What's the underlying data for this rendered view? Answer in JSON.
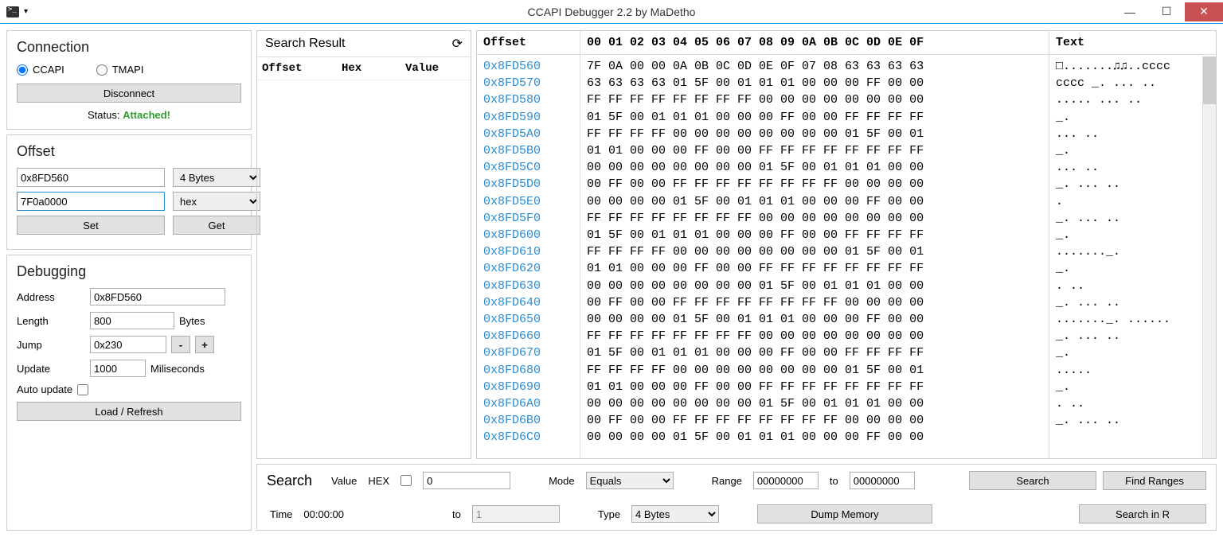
{
  "window": {
    "title": "CCAPI Debugger 2.2 by MaDetho"
  },
  "connection": {
    "title": "Connection",
    "radio_ccapi": "CCAPI",
    "radio_tmapi": "TMAPI",
    "disconnect": "Disconnect",
    "status_label": "Status: ",
    "status_value": "Attached!"
  },
  "offset": {
    "title": "Offset",
    "addr": "0x8FD560",
    "val": "7F0a0000",
    "size_options": "4 Bytes",
    "format": "hex",
    "set": "Set",
    "get": "Get"
  },
  "debugging": {
    "title": "Debugging",
    "address_label": "Address",
    "address": "0x8FD560",
    "length_label": "Length",
    "length": "800",
    "length_unit": "Bytes",
    "jump_label": "Jump",
    "jump": "0x230",
    "update_label": "Update",
    "update": "1000",
    "update_unit": "Miliseconds",
    "autoupdate": "Auto update",
    "load": "Load / Refresh"
  },
  "search_result": {
    "title": "Search Result",
    "col_offset": "Offset",
    "col_hex": "Hex",
    "col_value": "Value"
  },
  "hex": {
    "offset_header": "Offset",
    "byte_header": "00 01 02 03 04 05 06 07 08 09 0A 0B 0C 0D 0E 0F",
    "text_header": "Text",
    "offsets": [
      "0x8FD560",
      "0x8FD570",
      "0x8FD580",
      "0x8FD590",
      "0x8FD5A0",
      "0x8FD5B0",
      "0x8FD5C0",
      "0x8FD5D0",
      "0x8FD5E0",
      "0x8FD5F0",
      "0x8FD600",
      "0x8FD610",
      "0x8FD620",
      "0x8FD630",
      "0x8FD640",
      "0x8FD650",
      "0x8FD660",
      "0x8FD670",
      "0x8FD680",
      "0x8FD690",
      "0x8FD6A0",
      "0x8FD6B0",
      "0x8FD6C0"
    ],
    "bytes": [
      "7F 0A 00 00 0A 0B 0C 0D 0E 0F 07 08 63 63 63 63",
      "63 63 63 63 01 5F 00 01 01 01 00 00 00 FF 00 00",
      "FF FF FF FF FF FF FF FF 00 00 00 00 00 00 00 00",
      "01 5F 00 01 01 01 00 00 00 FF 00 00 FF FF FF FF",
      "FF FF FF FF 00 00 00 00 00 00 00 00 01 5F 00 01",
      "01 01 00 00 00 FF 00 00 FF FF FF FF FF FF FF FF",
      "00 00 00 00 00 00 00 00 01 5F 00 01 01 01 00 00",
      "00 FF 00 00 FF FF FF FF FF FF FF FF 00 00 00 00",
      "00 00 00 00 01 5F 00 01 01 01 00 00 00 FF 00 00",
      "FF FF FF FF FF FF FF FF 00 00 00 00 00 00 00 00",
      "01 5F 00 01 01 01 00 00 00 FF 00 00 FF FF FF FF",
      "FF FF FF FF 00 00 00 00 00 00 00 00 01 5F 00 01",
      "01 01 00 00 00 FF 00 00 FF FF FF FF FF FF FF FF",
      "00 00 00 00 00 00 00 00 01 5F 00 01 01 01 00 00",
      "00 FF 00 00 FF FF FF FF FF FF FF FF 00 00 00 00",
      "00 00 00 00 01 5F 00 01 01 01 00 00 00 FF 00 00",
      "FF FF FF FF FF FF FF FF 00 00 00 00 00 00 00 00",
      "01 5F 00 01 01 01 00 00 00 FF 00 00 FF FF FF FF",
      "FF FF FF FF 00 00 00 00 00 00 00 00 01 5F 00 01",
      "01 01 00 00 00 FF 00 00 FF FF FF FF FF FF FF FF",
      "00 00 00 00 00 00 00 00 01 5F 00 01 01 01 00 00",
      "00 FF 00 00 FF FF FF FF FF FF FF FF 00 00 00 00",
      "00 00 00 00 01 5F 00 01 01 01 00 00 00 FF 00 00"
    ],
    "text": [
      "□.......♫♫..cccc",
      "cccc _.   ... ..",
      "                ",
      ".....     ... ..",
      "            _.  ",
      "    ... ..      ",
      "        _.      ",
      "       ... ..   ",
      "    _.   ... ..",
      ".               ",
      " _.   ... ..    ",
      "            _.  ",
      "......._.       ",
      "        _.      ",
      ". ..            ",
      "    _.   ... ..",
      "......._. ......",
      " _.   ... ..    ",
      "            _.  ",
      ".....           ",
      "        _.      ",
      ". ..            ",
      "    _.   ... .."
    ]
  },
  "search": {
    "title": "Search",
    "value_label": "Value",
    "hex_label": "HEX",
    "value": "0",
    "mode_label": "Mode",
    "mode": "Equals",
    "range_label": "Range",
    "range_from": "00000000",
    "to_label": "to",
    "range_to": "00000000",
    "search_btn": "Search",
    "find_ranges_btn": "Find Ranges",
    "time_label": "Time",
    "time": "00:00:00",
    "to2_label": "to",
    "to2_val": "1",
    "type_label": "Type",
    "type": "4 Bytes",
    "dump_btn": "Dump Memory",
    "search_in_btn": "Search in R"
  }
}
